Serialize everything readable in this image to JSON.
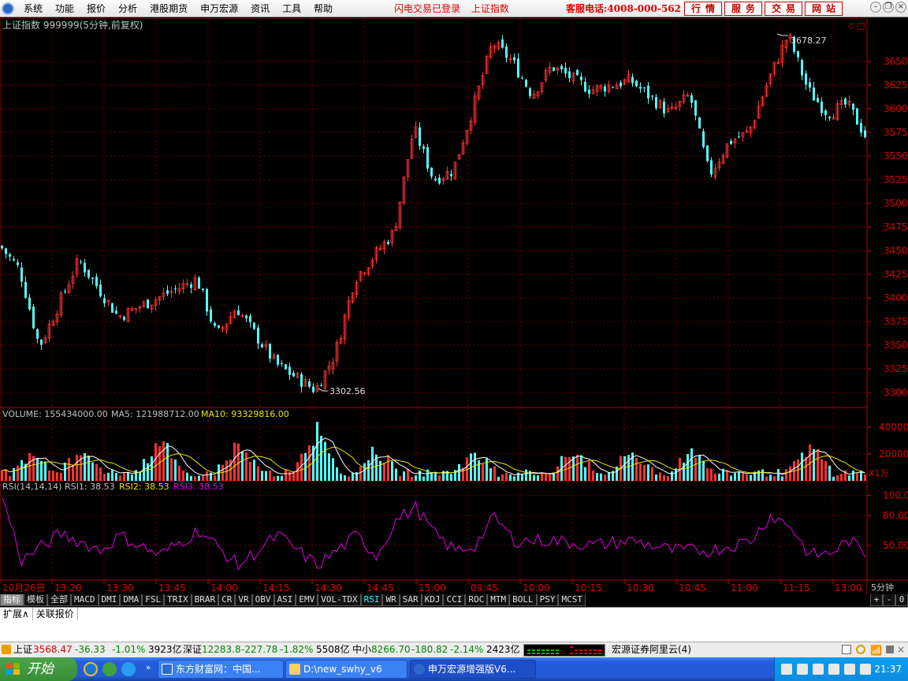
{
  "menubar": {
    "items": [
      "系统",
      "功能",
      "报价",
      "分析",
      "港股期货",
      "申万宏源",
      "资讯",
      "工具",
      "帮助"
    ],
    "flash_trade": "闪电交易已登录",
    "current_index": "上证指数",
    "hotline": "客服电话:4008-000-562",
    "quick_buttons": [
      "行情",
      "服务",
      "交易",
      "网站"
    ]
  },
  "chart_header": {
    "title": "上证指数 999999(5分钟,前复权)",
    "max_label": "3678.27",
    "min_label": "3302.56"
  },
  "volume_header": {
    "volume": "VOLUME: 155434000.00",
    "ma5": "MA5: 121988712.00",
    "ma10": "MA10: 93329816.00",
    "unit": "X1万"
  },
  "rsi_header": {
    "name": "RSI(14,14,14)",
    "rsi1": "RSI1: 38.53",
    "rsi2": "RSI2: 38.53",
    "rsi3": "RSI3: 38.53"
  },
  "period_label": "5分钟",
  "indicator_tabs": [
    "指标",
    "模板",
    "全部",
    "MACD",
    "DMI",
    "DMA",
    "FSL",
    "TRIX",
    "BRAR",
    "CR",
    "VR",
    "OBV",
    "ASI",
    "EMV",
    "VOL-TDX",
    "RSI",
    "WR",
    "SAR",
    "KDJ",
    "CCI",
    "ROC",
    "MTM",
    "BOLL",
    "PSY",
    "MCST"
  ],
  "active_indicator": "RSI",
  "tab_controls": [
    "+",
    "-",
    "0"
  ],
  "sub_tabs": [
    "扩展∧",
    "关联报价"
  ],
  "statusbar": {
    "sh_label": "上证",
    "sh_value": "3568.47",
    "sh_change": "-36.33",
    "sh_pct": "-1.01%",
    "sh_amount": "3923亿",
    "sz_label": "深证",
    "sz_value": "12283.8",
    "sz_change": "-227.78",
    "sz_pct": "-1.82%",
    "sz_amount": "5508亿",
    "zx_label": "中小",
    "zx_value": "8266.70",
    "zx_change": "-180.82",
    "zx_pct": "-2.14%",
    "zx_amount": "2423亿",
    "server": "宏源证券阿里云(4)"
  },
  "taskbar": {
    "start": "开始",
    "windows": [
      "东方财富网：中国...",
      "D:\\new_swhy_v6",
      "申万宏源增强版V6..."
    ],
    "clock": "21:37"
  },
  "chart_data": [
    {
      "type": "candlestick",
      "title": "上证指数 999999(5分钟,前复权)",
      "y_ticks": [
        3300,
        3325,
        3350,
        3375,
        3400,
        3425,
        3450,
        3475,
        3500,
        3525,
        3550,
        3575,
        3600,
        3625,
        3650
      ],
      "ylim": [
        3295,
        3685
      ],
      "x_ticks": [
        "10月26日",
        "13:20",
        "13:30",
        "13:45",
        "14:00",
        "14:15",
        "14:30",
        "14:45",
        "15:00",
        "09:45",
        "10:00",
        "10:15",
        "10:30",
        "10:45",
        "11:00",
        "11:15",
        "13:00"
      ],
      "max": 3678.27,
      "min": 3302.56,
      "last": 3568.47,
      "approx_close_path": [
        [
          0,
          3455
        ],
        [
          5,
          3430
        ],
        [
          10,
          3348
        ],
        [
          20,
          3440
        ],
        [
          30,
          3380
        ],
        [
          40,
          3400
        ],
        [
          50,
          3420
        ],
        [
          55,
          3360
        ],
        [
          60,
          3390
        ],
        [
          70,
          3330
        ],
        [
          80,
          3302.56
        ],
        [
          85,
          3340
        ],
        [
          90,
          3420
        ],
        [
          100,
          3470
        ],
        [
          105,
          3580
        ],
        [
          110,
          3525
        ],
        [
          115,
          3535
        ],
        [
          120,
          3600
        ],
        [
          125,
          3670
        ],
        [
          130,
          3650
        ],
        [
          135,
          3615
        ],
        [
          140,
          3645
        ],
        [
          150,
          3620
        ],
        [
          160,
          3630
        ],
        [
          170,
          3595
        ],
        [
          175,
          3615
        ],
        [
          180,
          3530
        ],
        [
          185,
          3565
        ],
        [
          190,
          3575
        ],
        [
          195,
          3630
        ],
        [
          200,
          3678.27
        ],
        [
          205,
          3620
        ],
        [
          210,
          3595
        ],
        [
          215,
          3605
        ],
        [
          220,
          3568.47
        ]
      ]
    },
    {
      "type": "bar",
      "name": "VOLUME",
      "unit": "X1万",
      "y_ticks": [
        20000,
        40000
      ],
      "ylim": [
        0,
        50000
      ],
      "peaks": [
        17000,
        17000,
        28000,
        23000,
        36000,
        19000,
        17000,
        19000,
        18000,
        18000,
        23000
      ]
    },
    {
      "type": "line",
      "name": "RSI(14,14,14)",
      "y_ticks": [
        50.0,
        80.0,
        100.0
      ],
      "ylim": [
        20,
        110
      ],
      "approx_path": [
        [
          0,
          100
        ],
        [
          5,
          35
        ],
        [
          15,
          62
        ],
        [
          25,
          45
        ],
        [
          30,
          60
        ],
        [
          40,
          40
        ],
        [
          50,
          65
        ],
        [
          60,
          30
        ],
        [
          70,
          60
        ],
        [
          80,
          30
        ],
        [
          90,
          60
        ],
        [
          95,
          40
        ],
        [
          100,
          75
        ],
        [
          105,
          88
        ],
        [
          110,
          60
        ],
        [
          115,
          45
        ],
        [
          120,
          50
        ],
        [
          125,
          78
        ],
        [
          130,
          55
        ],
        [
          140,
          55
        ],
        [
          150,
          50
        ],
        [
          160,
          55
        ],
        [
          170,
          45
        ],
        [
          180,
          45
        ],
        [
          190,
          55
        ],
        [
          195,
          80
        ],
        [
          200,
          70
        ],
        [
          205,
          40
        ],
        [
          210,
          42
        ],
        [
          215,
          55
        ],
        [
          220,
          38.53
        ]
      ]
    }
  ]
}
